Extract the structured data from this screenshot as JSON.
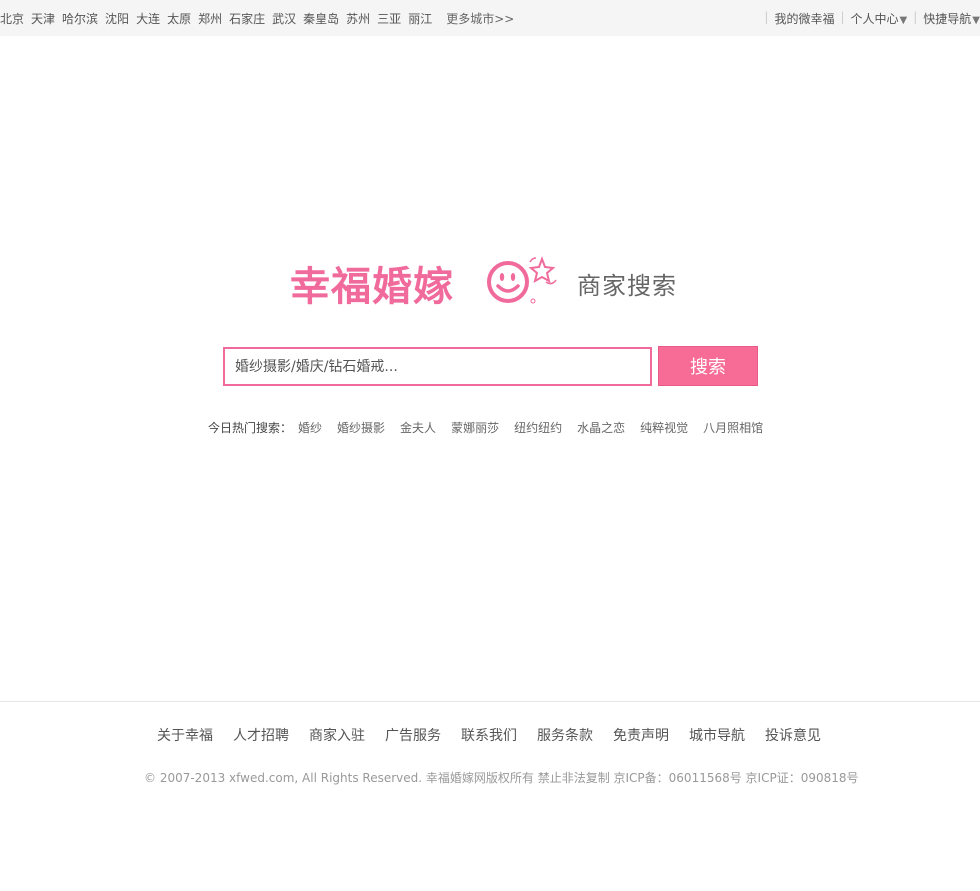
{
  "topbar": {
    "cities": [
      "北京",
      "天津",
      "哈尔滨",
      "沈阳",
      "大连",
      "太原",
      "郑州",
      "石家庄",
      "武汉",
      "秦皇岛",
      "苏州",
      "三亚",
      "丽江"
    ],
    "more_cities": "更多城市>>",
    "links": {
      "my_weixin": "我的微幸福",
      "personal_center": "个人中心",
      "quick_nav": "快捷导航"
    },
    "arrow_glyph": "▼"
  },
  "logo": {
    "brand": "幸福婚嫁",
    "subtitle": "商家搜索",
    "brand_color": "#f06a9b"
  },
  "search": {
    "placeholder": "婚纱摄影/婚庆/钻石婚戒...",
    "button_label": "搜索",
    "button_color": "#f76c96"
  },
  "hot_search": {
    "label": "今日热门搜索：",
    "items": [
      "婚纱",
      "婚纱摄影",
      "金夫人",
      "蒙娜丽莎",
      "纽约纽约",
      "水晶之恋",
      "纯粹视觉",
      "八月照相馆"
    ]
  },
  "footer": {
    "links": [
      "关于幸福",
      "人才招聘",
      "商家入驻",
      "广告服务",
      "联系我们",
      "服务条款",
      "免责声明",
      "城市导航",
      "投诉意见"
    ],
    "copyright": "© 2007-2013 xfwed.com, All Rights Reserved. 幸福婚嫁网版权所有 禁止非法复制 京ICP备：06011568号 京ICP证：090818号"
  }
}
